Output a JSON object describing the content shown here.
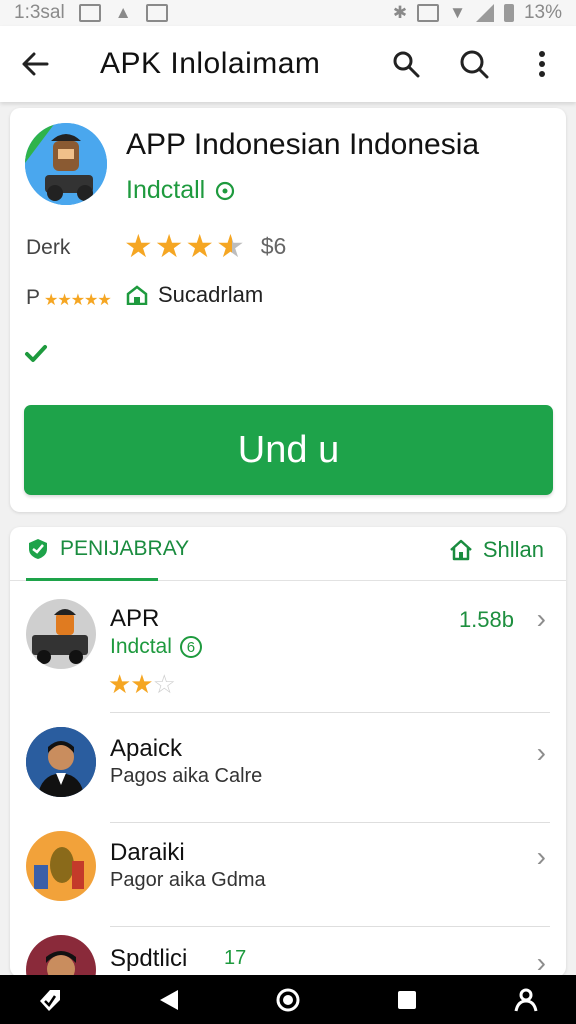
{
  "status_bar": {
    "time": "1:3sal",
    "battery": "13%"
  },
  "app_bar": {
    "title": "APK Inlolaimam",
    "icons": [
      "arrow-back-icon",
      "search-icon",
      "search-icon",
      "more-vert-icon"
    ]
  },
  "app_card": {
    "name": "APP Indonesian Indonesia",
    "install_label": "Indctall",
    "rating_label": "Derk",
    "rating_stars": 3.5,
    "price": "$6",
    "secondary_label": "P",
    "vendor": "Sucadrlam",
    "action_label": "Und u"
  },
  "tabs": {
    "left_label": "PENIJABRAY",
    "right_label": "Shllan"
  },
  "list": {
    "items": [
      {
        "title": "APR",
        "subtitle": "Indctal",
        "subtitle_badge": "6",
        "stars": 2.5,
        "value": "1.58b"
      },
      {
        "title": "Apaick",
        "subtitle": "Pagos aika Calre"
      },
      {
        "title": "Daraiki",
        "subtitle": "Pagor aika Gdma"
      },
      {
        "title": "Spdtlici",
        "badge": "17"
      }
    ]
  },
  "colors": {
    "accent": "#1ea34a",
    "star": "#f5a623",
    "text_primary": "#111111"
  }
}
